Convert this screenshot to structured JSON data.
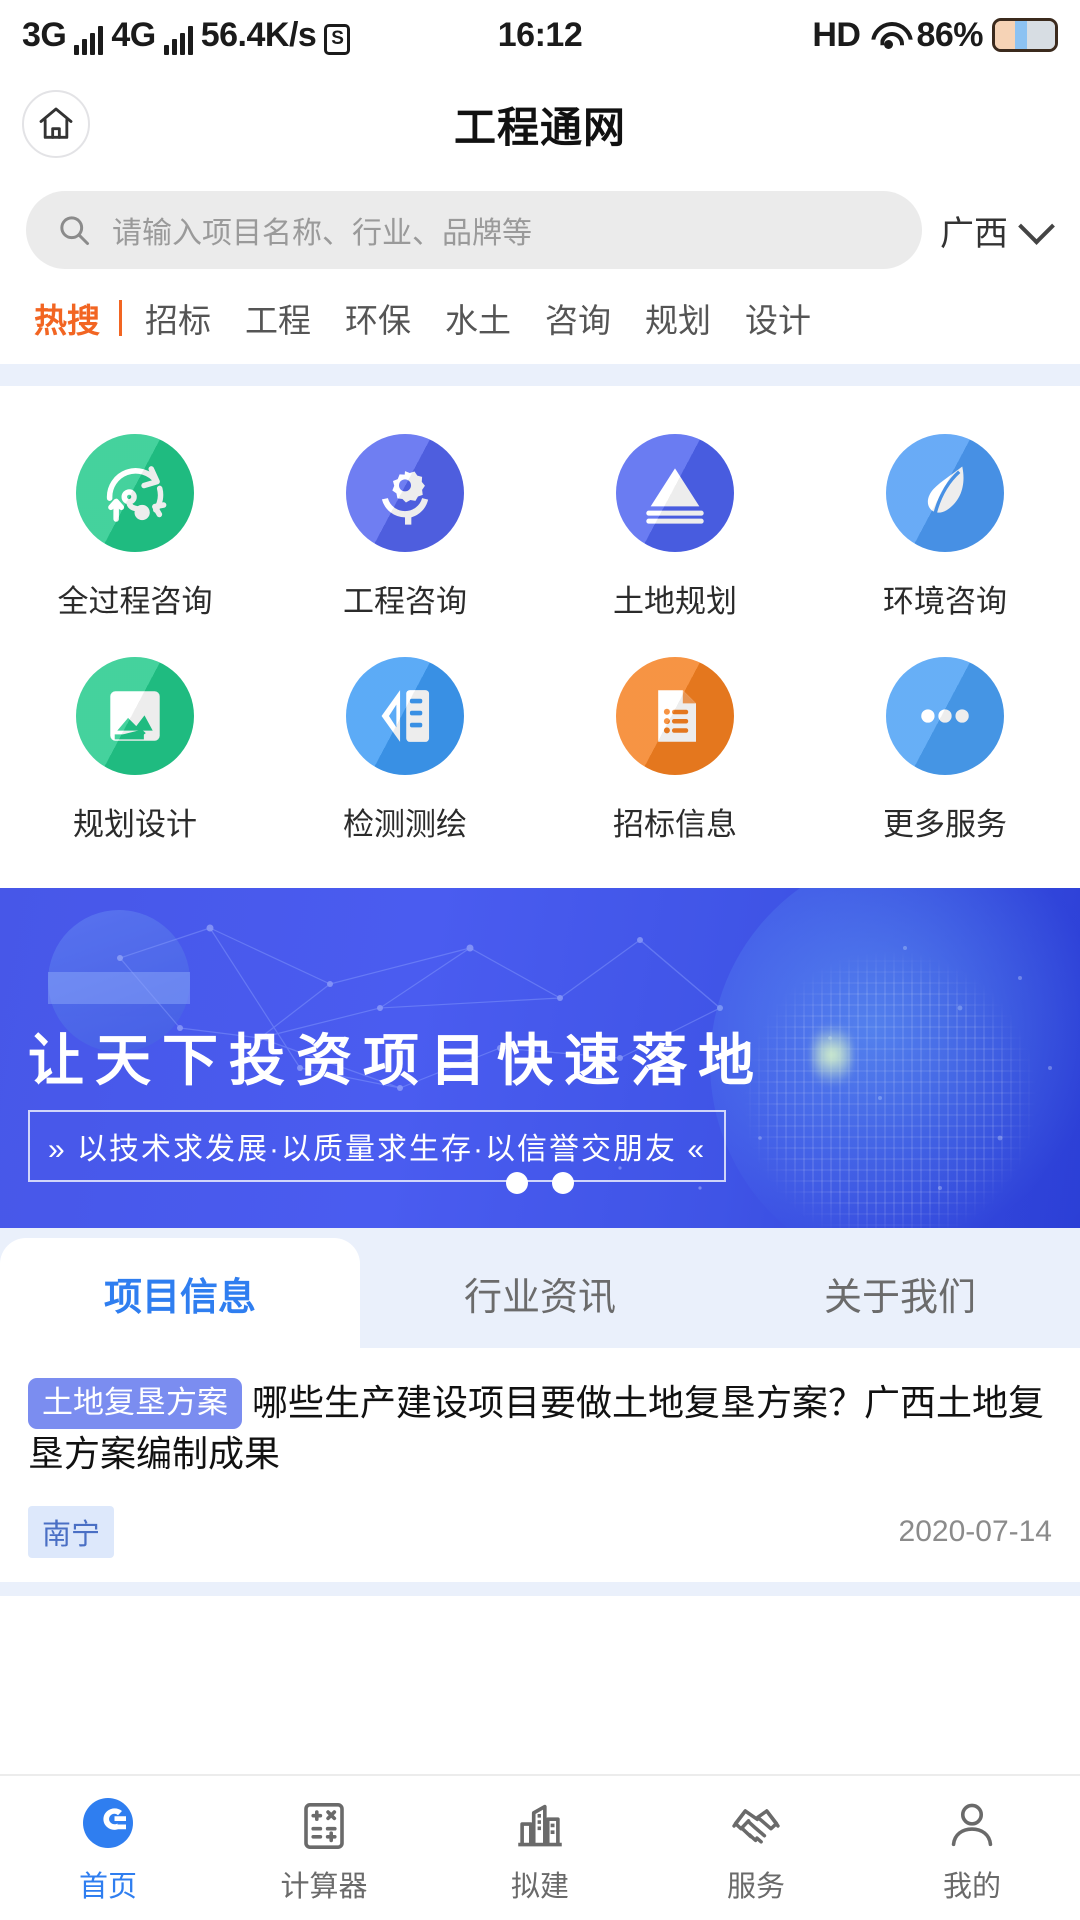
{
  "status_bar": {
    "net1": "3G",
    "net2": "4G",
    "speed": "56.4K/s",
    "sim_icon": "S",
    "time": "16:12",
    "hd": "HD",
    "wifi_icon": "wifi-icon",
    "battery": "86%"
  },
  "header": {
    "home_icon": "home-icon",
    "title": "工程通网"
  },
  "search": {
    "icon": "search-icon",
    "placeholder": "请输入项目名称、行业、品牌等",
    "value": "",
    "region": "广西",
    "region_chevron": "chevron-down-icon"
  },
  "hot_tabs": {
    "active": "热搜",
    "items": [
      "热搜",
      "招标",
      "工程",
      "环保",
      "水土",
      "咨询",
      "规划",
      "设计"
    ]
  },
  "services": [
    {
      "label": "全过程咨询",
      "icon": "process-cycle-icon",
      "color": "#21c98a"
    },
    {
      "label": "工程咨询",
      "icon": "gear-consult-icon",
      "color": "#5465ef"
    },
    {
      "label": "土地规划",
      "icon": "mountain-land-icon",
      "color": "#4d63f0"
    },
    {
      "label": "环境咨询",
      "icon": "leaf-icon",
      "color": "#4c9bf5"
    },
    {
      "label": "规划设计",
      "icon": "design-draw-icon",
      "color": "#21c98a"
    },
    {
      "label": "检测测绘",
      "icon": "ruler-survey-icon",
      "color": "#3d9bf5"
    },
    {
      "label": "招标信息",
      "icon": "bid-list-icon",
      "color": "#f58020"
    },
    {
      "label": "更多服务",
      "icon": "more-dots-icon",
      "color": "#4aa0f5"
    }
  ],
  "banner": {
    "title": "让天下投资项目快速落地",
    "subtitle": "以技术求发展·以质量求生存·以信誉交朋友",
    "subtitle_left_mark": "»",
    "subtitle_right_mark": "«",
    "slides": 2,
    "active_slide": 1,
    "bg_color": "#4354e8"
  },
  "content_tabs": {
    "active": "项目信息",
    "items": [
      "项目信息",
      "行业资讯",
      "关于我们"
    ],
    "active_color": "#2f7ef0"
  },
  "articles": [
    {
      "tag": "土地复垦方案",
      "title": "哪些生产建设项目要做土地复垦方案？广西土地复垦方案编制成果",
      "city": "南宁",
      "date": "2020-07-14"
    }
  ],
  "bottom_nav": {
    "active": "首页",
    "items": [
      {
        "label": "首页",
        "icon": "home-logo-icon"
      },
      {
        "label": "计算器",
        "icon": "calculator-icon"
      },
      {
        "label": "拟建",
        "icon": "buildings-icon"
      },
      {
        "label": "服务",
        "icon": "handshake-icon"
      },
      {
        "label": "我的",
        "icon": "user-person-icon"
      }
    ]
  }
}
